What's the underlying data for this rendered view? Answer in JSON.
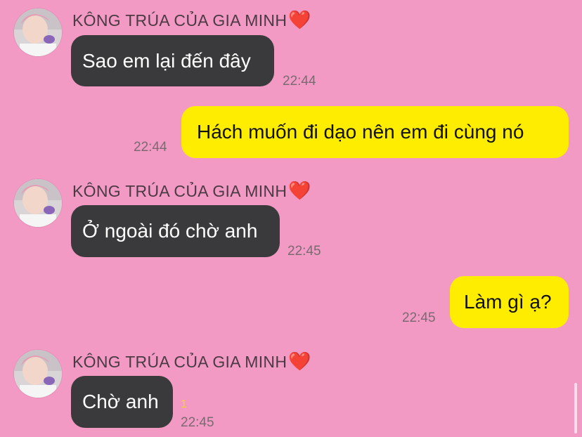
{
  "chat": {
    "sender_name": "KÔNG TRÚA CỦA GIA MINH",
    "sender_emoji": "❤️",
    "messages": [
      {
        "side": "in",
        "text": "Sao em lại đến đây",
        "time": "22:44"
      },
      {
        "side": "out",
        "text": "Hách muốn đi dạo nên em đi cùng nó",
        "time": "22:44"
      },
      {
        "side": "in",
        "text": "Ở ngoài đó chờ anh",
        "time": "22:45"
      },
      {
        "side": "out",
        "text": "Làm gì ạ?",
        "time": "22:45"
      },
      {
        "side": "in",
        "text": "Chờ anh",
        "time": "22:45",
        "unread_count": "1"
      }
    ]
  },
  "colors": {
    "background": "#F29AC4",
    "incoming_bubble": "#3A3A3C",
    "outgoing_bubble": "#FFED00",
    "unread_indicator": "#F6D22C"
  }
}
